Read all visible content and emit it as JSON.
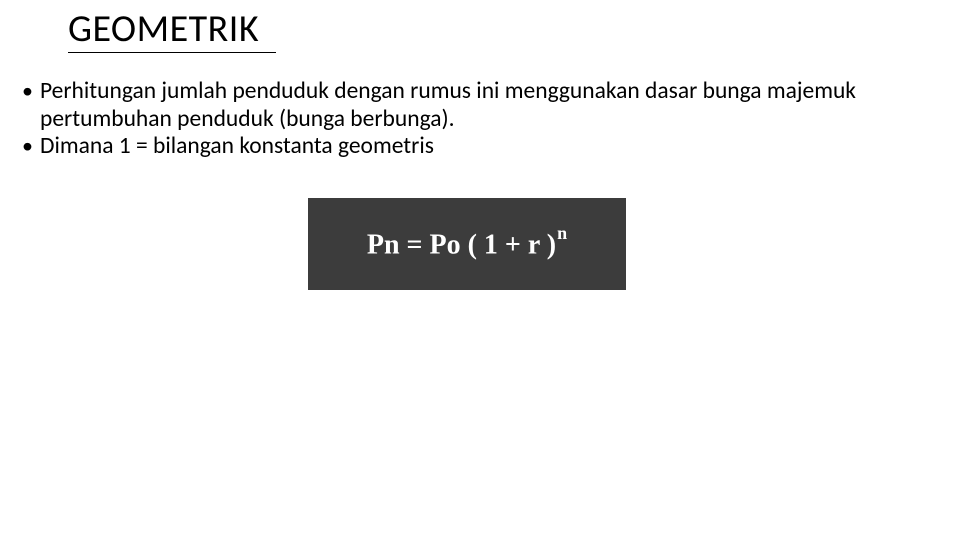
{
  "title": "GEOMETRIK",
  "bullets": [
    "Perhitungan jumlah penduduk dengan rumus ini menggunakan dasar bunga majemuk pertumbuhan penduduk (bunga berbunga).",
    "Dimana 1  =  bilangan konstanta geometris"
  ],
  "formula": {
    "base": "Pn = Po ( 1 + r )",
    "exponent": "n"
  }
}
